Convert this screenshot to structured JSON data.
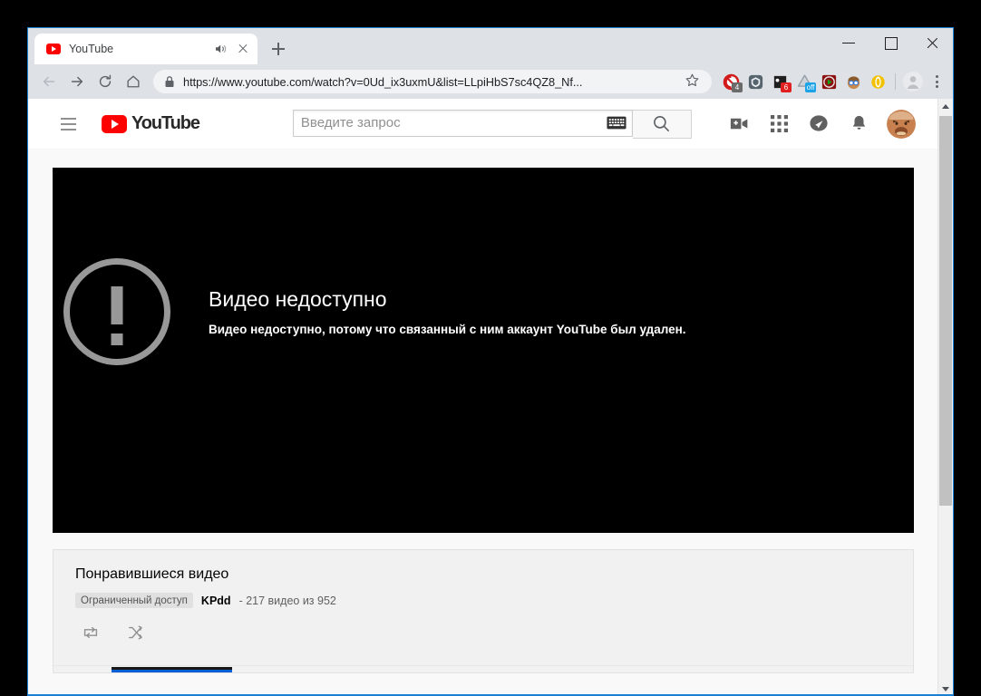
{
  "window": {
    "controls": {
      "minimize": "minimize-button",
      "maximize": "maximize-button",
      "close": "close-button"
    }
  },
  "browser": {
    "tab": {
      "title": "YouTube",
      "favicon": "youtube-favicon",
      "audio_icon": "speaker-playing-icon",
      "close_icon": "close-icon"
    },
    "new_tab_label": "+",
    "nav": {
      "back": "back-arrow-icon",
      "forward": "forward-arrow-icon",
      "reload": "reload-icon",
      "home": "home-icon"
    },
    "omnibox": {
      "url": "https://www.youtube.com/watch?v=0Ud_ix3uxmU&list=LLpiHbS7sc4QZ8_Nf...",
      "lock_icon": "lock-icon",
      "star_icon": "star-icon"
    },
    "extensions": [
      {
        "name": "adblock-extension",
        "badge": "4",
        "badge_style": "gray",
        "color": "#d21b1b"
      },
      {
        "name": "ghostery-extension",
        "badge": "",
        "badge_style": "",
        "color": "#3b4a52"
      },
      {
        "name": "notes-extension",
        "badge": "6",
        "badge_style": "red",
        "color": "#1f1f1f"
      },
      {
        "name": "vpn-extension",
        "badge": "off",
        "badge_style": "blue",
        "color": "#9aa4ad"
      },
      {
        "name": "video-downloader-extension",
        "badge": "",
        "badge_style": "",
        "color": "#8b1111"
      },
      {
        "name": "user-agent-extension",
        "badge": "",
        "badge_style": "",
        "color": "#c07b3e"
      },
      {
        "name": "opera-extension",
        "badge": "",
        "badge_style": "",
        "color": "#f2c200"
      }
    ],
    "profile_icon": "profile-avatar-icon",
    "menu_icon": "chrome-menu-icon"
  },
  "youtube": {
    "guide_icon": "hamburger-menu-icon",
    "logo_text": "YouTube",
    "search": {
      "placeholder": "Введите запрос",
      "value": "",
      "keyboard_icon": "keyboard-icon",
      "submit_icon": "search-icon"
    },
    "masthead_buttons": [
      {
        "name": "create-video-icon"
      },
      {
        "name": "apps-grid-icon"
      },
      {
        "name": "messages-icon"
      },
      {
        "name": "notifications-bell-icon"
      }
    ],
    "avatar": "user-avatar",
    "player": {
      "error_icon": "exclamation-circle-icon",
      "error_title": "Видео недоступно",
      "error_subtitle": "Видео недоступно, потому что связанный с ним аккаунт YouTube был удален."
    },
    "playlist": {
      "title": "Понравившиеся видео",
      "badge": "Ограниченный доступ",
      "owner": "KPdd",
      "count": "- 217 видео из 952",
      "controls": [
        {
          "name": "loop-icon"
        },
        {
          "name": "shuffle-icon"
        }
      ]
    }
  },
  "colors": {
    "youtube_red": "#ff0000",
    "chrome_chrome": "#dee1e6",
    "page_bg": "#f9f9f9",
    "accent_blue": "#065fd4",
    "window_border": "#1b7fd4"
  }
}
